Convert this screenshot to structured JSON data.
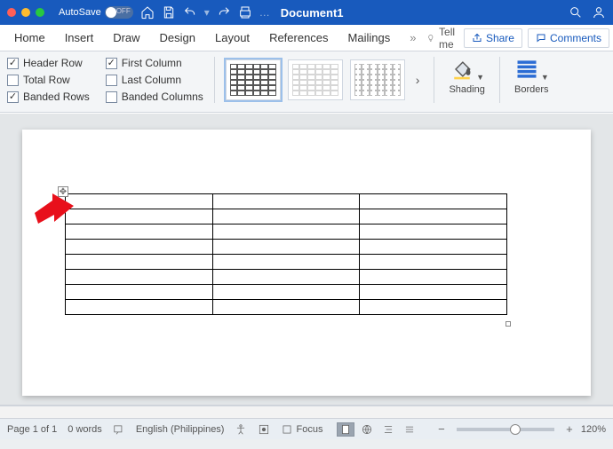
{
  "titlebar": {
    "autosave_label": "AutoSave",
    "autosave_state": "OFF",
    "ellipsis": "…",
    "doc_title": "Document1"
  },
  "tabs": {
    "home": "Home",
    "insert": "Insert",
    "draw": "Draw",
    "design": "Design",
    "layout": "Layout",
    "references": "References",
    "mailings": "Mailings",
    "more": "»",
    "tell_me": "Tell me"
  },
  "actions": {
    "share": "Share",
    "comments": "Comments"
  },
  "ribbon": {
    "header_row": "Header Row",
    "total_row": "Total Row",
    "banded_rows": "Banded Rows",
    "first_column": "First Column",
    "last_column": "Last Column",
    "banded_columns": "Banded Columns",
    "shading": "Shading",
    "borders": "Borders"
  },
  "table": {
    "rows": 8,
    "cols": 3
  },
  "status": {
    "page": "Page 1 of 1",
    "words": "0 words",
    "language": "English (Philippines)",
    "focus": "Focus",
    "zoom": "120%"
  }
}
